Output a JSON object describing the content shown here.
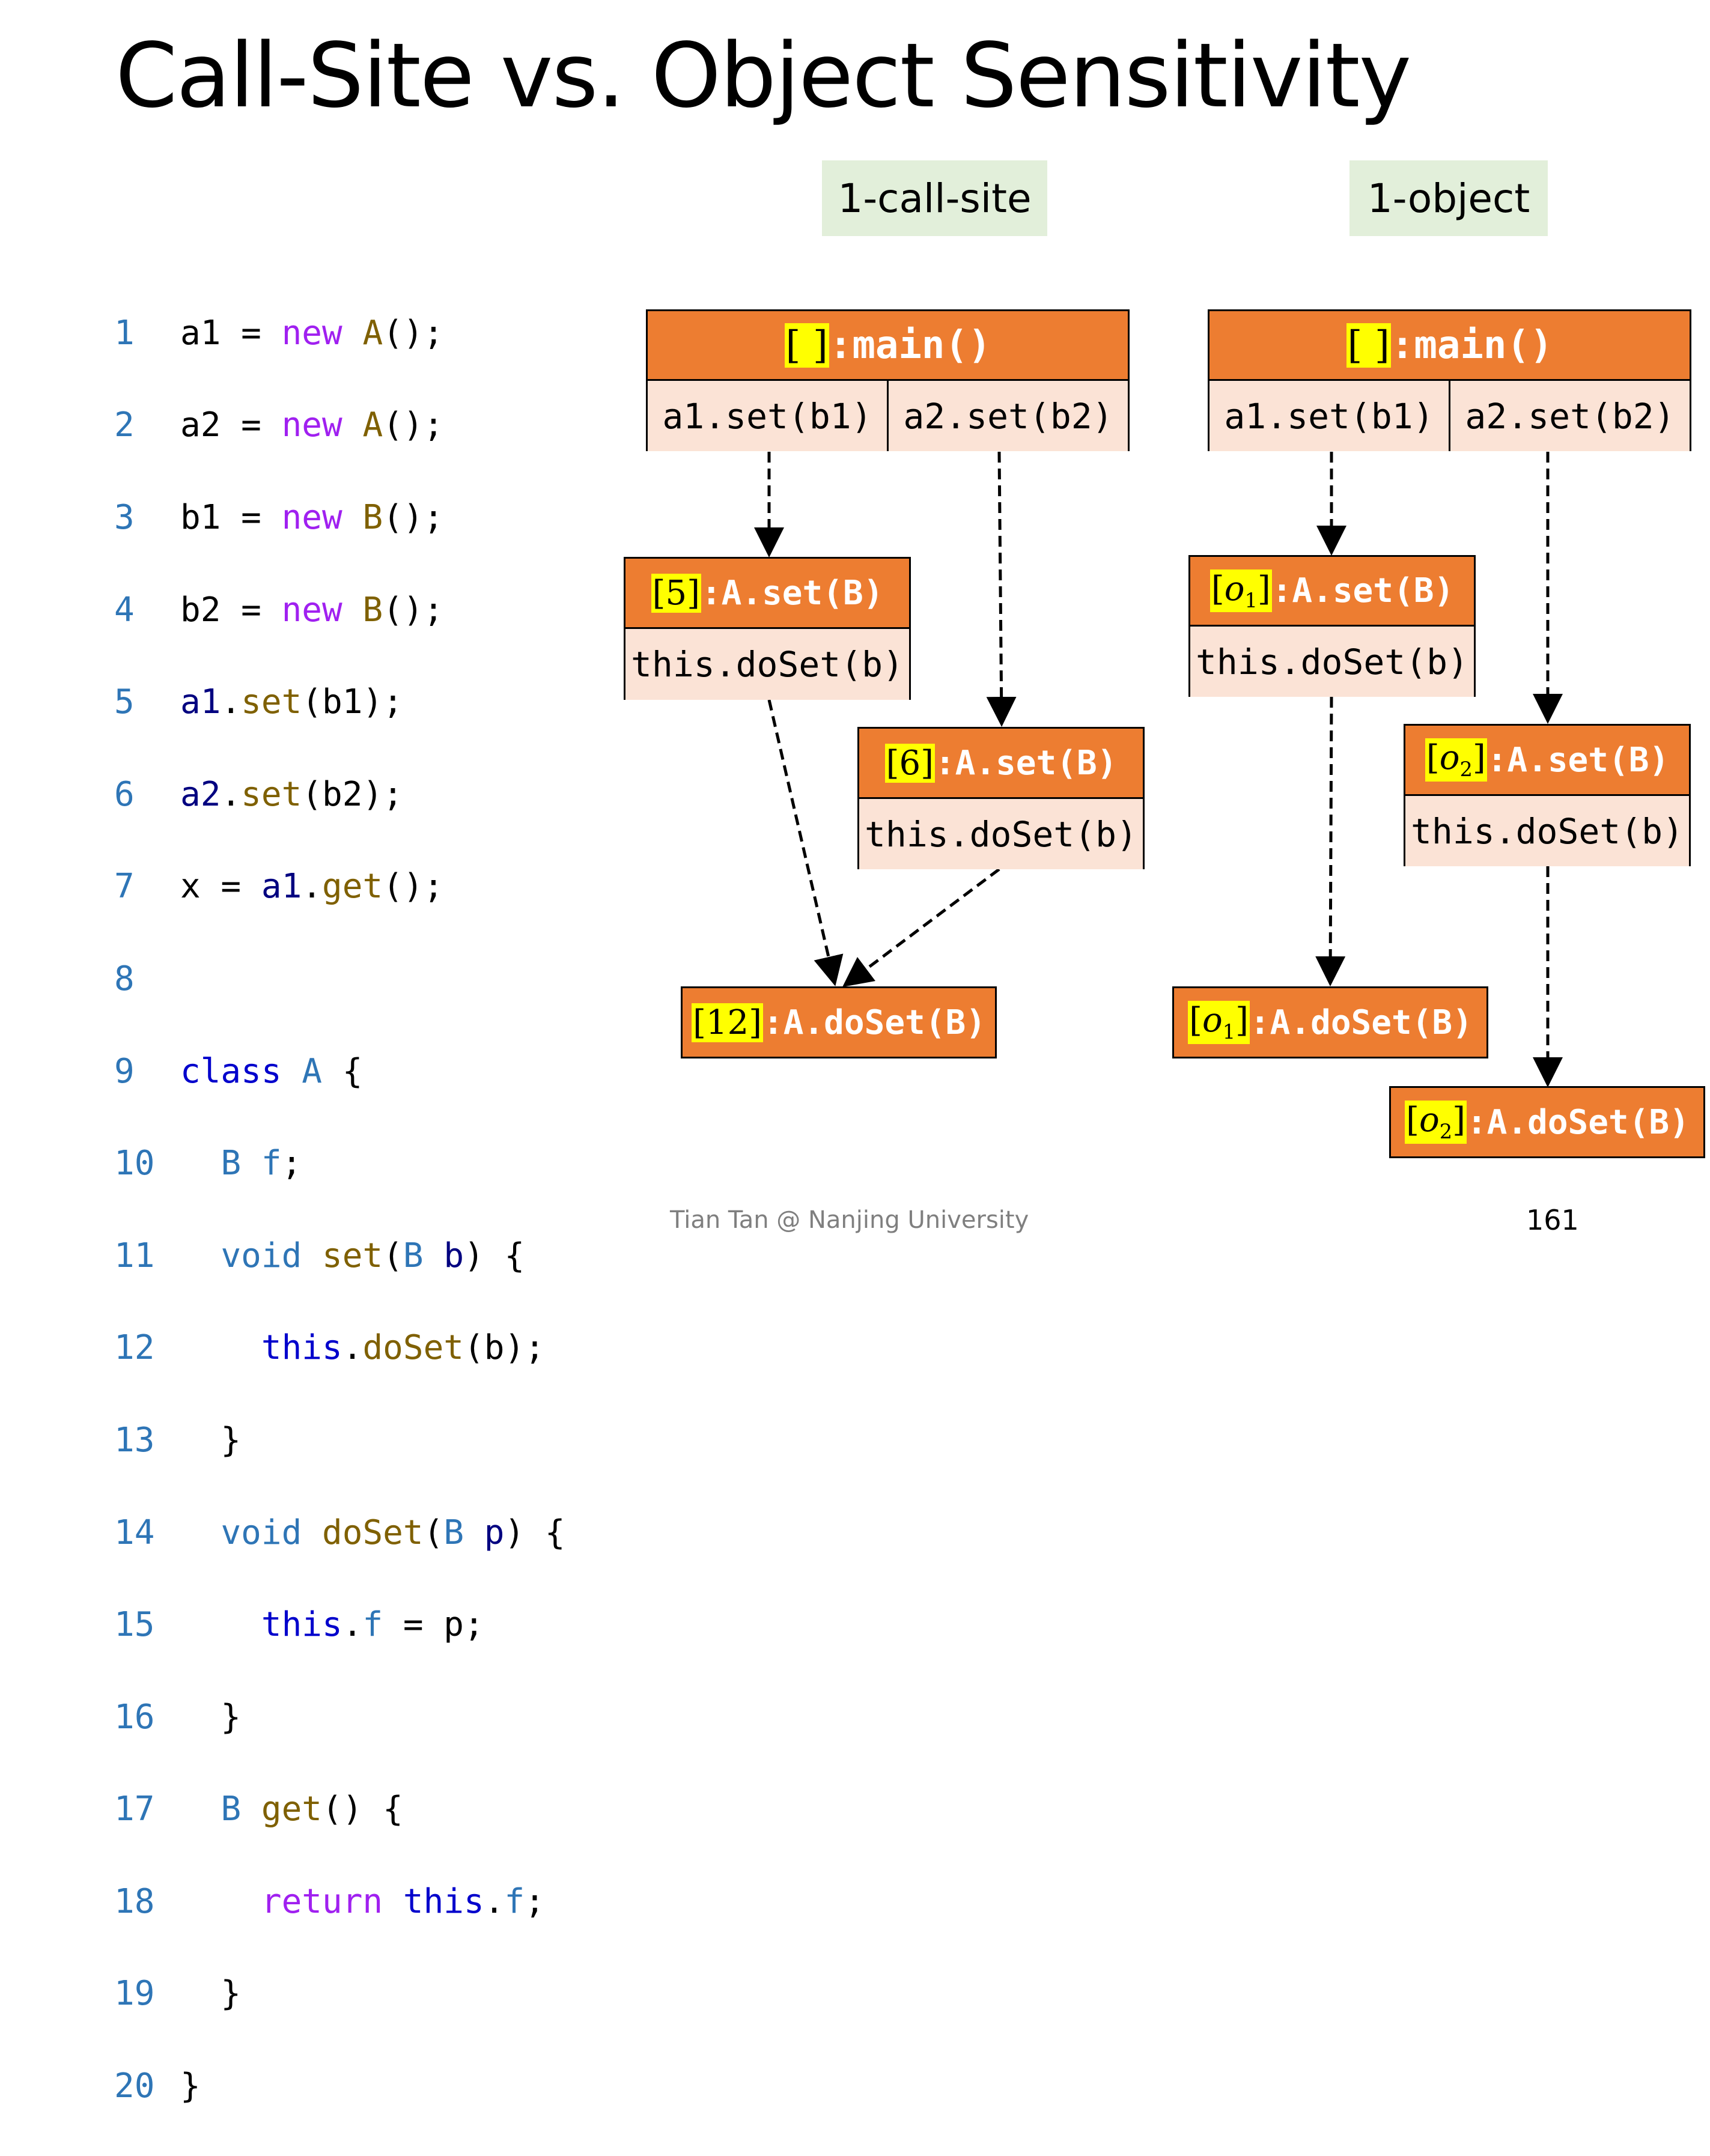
{
  "title": "Call-Site vs. Object Sensitivity",
  "labels": {
    "left": "1-call-site",
    "right": "1-object"
  },
  "code": {
    "numbers": [
      "1",
      "2",
      "3",
      "4",
      "5",
      "6",
      "7",
      "8",
      "9",
      "10",
      "11",
      "12",
      "13",
      "14",
      "15",
      "16",
      "17",
      "18",
      "19",
      "20"
    ]
  },
  "call_site_graph": {
    "main_ctx": "[ ]",
    "main_method": ":main()",
    "main_call1": "a1.set(b1)",
    "main_call2": "a2.set(b2)",
    "set5_ctx": "[5]",
    "set5_method": ":A.set(B)",
    "set5_call": "this.doSet(b)",
    "set6_ctx": "[6]",
    "set6_method": ":A.set(B)",
    "set6_call": "this.doSet(b)",
    "doset12_ctx": "[12]",
    "doset12_method": ":A.doSet(B)"
  },
  "object_graph": {
    "main_ctx": "[ ]",
    "main_method": ":main()",
    "main_call1": "a1.set(b1)",
    "main_call2": "a2.set(b2)",
    "set_o1_ctx_open": "[",
    "set_o1_ctx_var": "o",
    "set_o1_ctx_sub": "1",
    "set_o1_ctx_close": "]",
    "set_o1_method": ":A.set(B)",
    "set_o1_call": "this.doSet(b)",
    "set_o2_ctx_open": "[",
    "set_o2_ctx_var": "o",
    "set_o2_ctx_sub": "2",
    "set_o2_ctx_close": "]",
    "set_o2_method": ":A.set(B)",
    "set_o2_call": "this.doSet(b)",
    "doset_o1_method": ":A.doSet(B)",
    "doset_o2_method": ":A.doSet(B)"
  },
  "footer": "Tian Tan @ Nanjing University",
  "page_number": "161",
  "colors": {
    "method_header": "#ed7d31",
    "call_cell": "#fbe3d6",
    "label_bg": "#e2efda",
    "context_highlight": "#ffff00"
  }
}
